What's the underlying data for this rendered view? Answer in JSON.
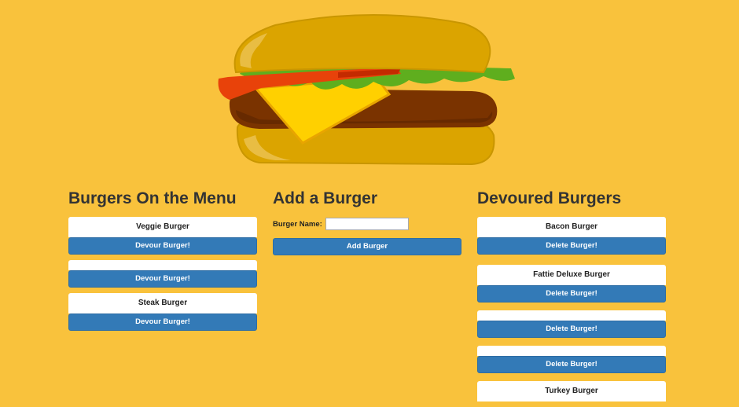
{
  "menu": {
    "title": "Burgers On the Menu",
    "items": [
      {
        "name": "Veggie Burger",
        "button": "Devour Burger!"
      },
      {
        "name": "",
        "button": "Devour Burger!"
      },
      {
        "name": "Steak Burger",
        "button": "Devour Burger!"
      }
    ]
  },
  "add": {
    "title": "Add a Burger",
    "label": "Burger Name:",
    "input_value": "",
    "button": "Add Burger"
  },
  "devoured": {
    "title": "Devoured Burgers",
    "items": [
      {
        "name": "Bacon Burger",
        "button": "Delete Burger!"
      },
      {
        "name": "Fattie Deluxe Burger",
        "button": "Delete Burger!"
      },
      {
        "name": "",
        "button": "Delete Burger!"
      },
      {
        "name": "",
        "button": "Delete Burger!"
      },
      {
        "name": "Turkey Burger",
        "button": ""
      }
    ]
  },
  "colors": {
    "background": "#f9c23c",
    "button": "#337ab7"
  },
  "hero_icon": "burger-illustration"
}
